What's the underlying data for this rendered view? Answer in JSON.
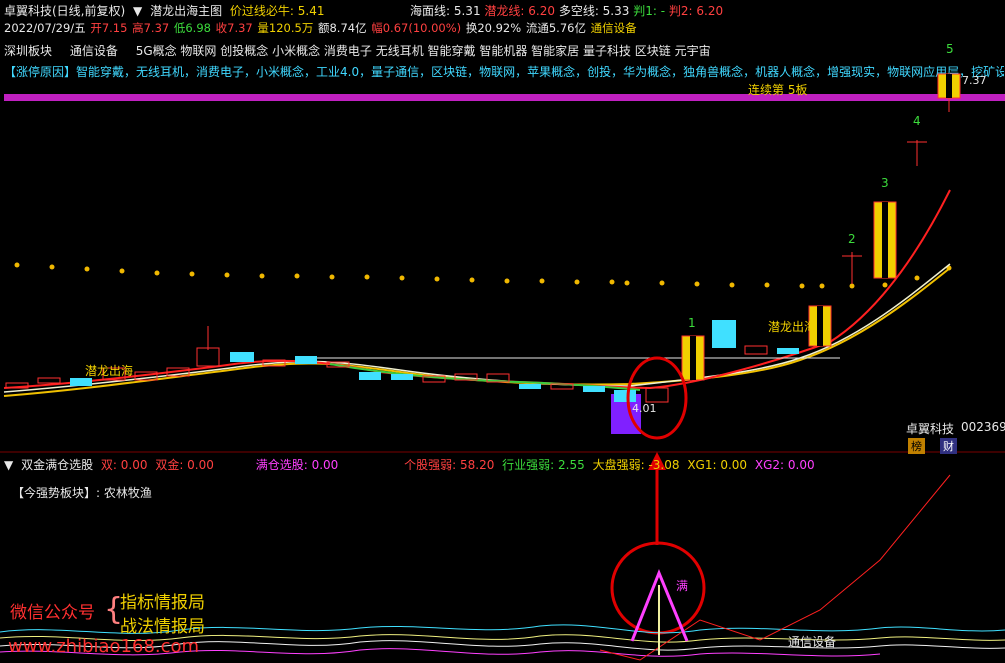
{
  "header": {
    "stock_title": "卓翼科技(日线,前复权)",
    "indicator_name": "潜龙出海主图",
    "price_line_label": "价过线必牛: 5.41",
    "sea_line_label": "海面线: 5.31",
    "dragon_line_label": "潜龙线: 6.20",
    "short_line_label": "多空线: 5.33",
    "judge1_label": "判1: -",
    "judge2_label": "判2: 6.20"
  },
  "quote": {
    "date": "2022/07/29/五",
    "open": "开7.15",
    "high": "高7.37",
    "low": "低6.98",
    "close": "收7.37",
    "volume": "量120.5万",
    "amount": "额8.74亿",
    "change": "幅0.67(10.00%)",
    "turnover": "换20.92%",
    "float": "流通5.76亿",
    "industry": "通信设备"
  },
  "concepts": {
    "region": "深圳板块",
    "industry": "通信设备",
    "list": "5G概念 物联网 创投概念 小米概念 消费电子 无线耳机 智能穿戴 智能机器 智能家居 量子科技 区块链 元宇宙"
  },
  "limit_reason": "【涨停原因】智能穿戴，无线耳机，消费电子，小米概念，工业4.0，量子通信，区块链，物联网，苹果概念，创投，华为概念，独角兽概念，机器人概念，增强现实，物联网应用层，挖矿设",
  "consecutive_label": "连续第  5板",
  "chart_labels": {
    "dragon_left": "潜龙出海",
    "dragon_right": "潜龙出海",
    "low_price": "4.01",
    "high_price": "7.37",
    "limit_counts": [
      "1",
      "2",
      "3",
      "4",
      "5"
    ],
    "stock_name": "卓翼科技",
    "stock_code": "002369",
    "tag_rank": "榜",
    "tag_finance": "财"
  },
  "sub_header": {
    "indicator_name": "双金满仓选股",
    "dual_label": "双: 0.00",
    "dual_gold_label": "双金: 0.00",
    "full_pos_label": "满仓选股: 0.00",
    "stock_strength": "个股强弱: 58.20",
    "industry_strength": "行业强弱: 2.55",
    "market_strength": "大盘强弱: -3.08",
    "xg1": "XG1: 0.00",
    "xg2": "XG2: 0.00"
  },
  "strong_sector": "【今强势板块】: 农林牧渔",
  "sub_labels": {
    "full": "满",
    "industry_line": "通信设备"
  },
  "watermark": {
    "wechat": "微信公众号",
    "brand1": "指标情报局",
    "brand2": "战法情报局",
    "site": "www.zhibiao168.com"
  },
  "icons": [
    "chevron-down-icon",
    "arrow-icon"
  ],
  "colors": {
    "background": "#000000",
    "up": "#ff3030",
    "down": "#40e0ff",
    "magenta": "#ff40ff",
    "yellow": "#f0d000",
    "annotation_red": "#e00000"
  }
}
